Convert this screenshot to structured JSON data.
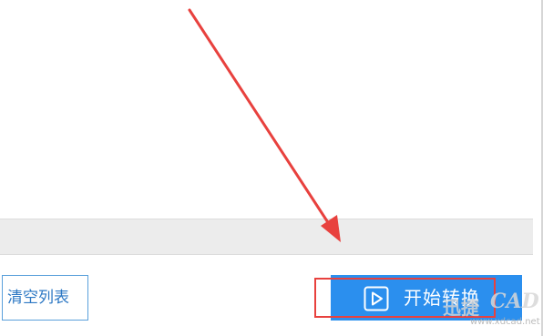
{
  "toolbar": {
    "clear_list_label": "清空列表",
    "start_convert_label": "开始转换",
    "start_icon": "play-icon"
  },
  "watermark": {
    "brand_cn": "迅捷",
    "brand_en": "CAD",
    "url": "www.xdcad.net"
  },
  "colors": {
    "start_button": "#2b8fee",
    "clear_button_border": "#5aa0db",
    "annotation_red": "#e8413e",
    "status_strip": "#ececec"
  }
}
